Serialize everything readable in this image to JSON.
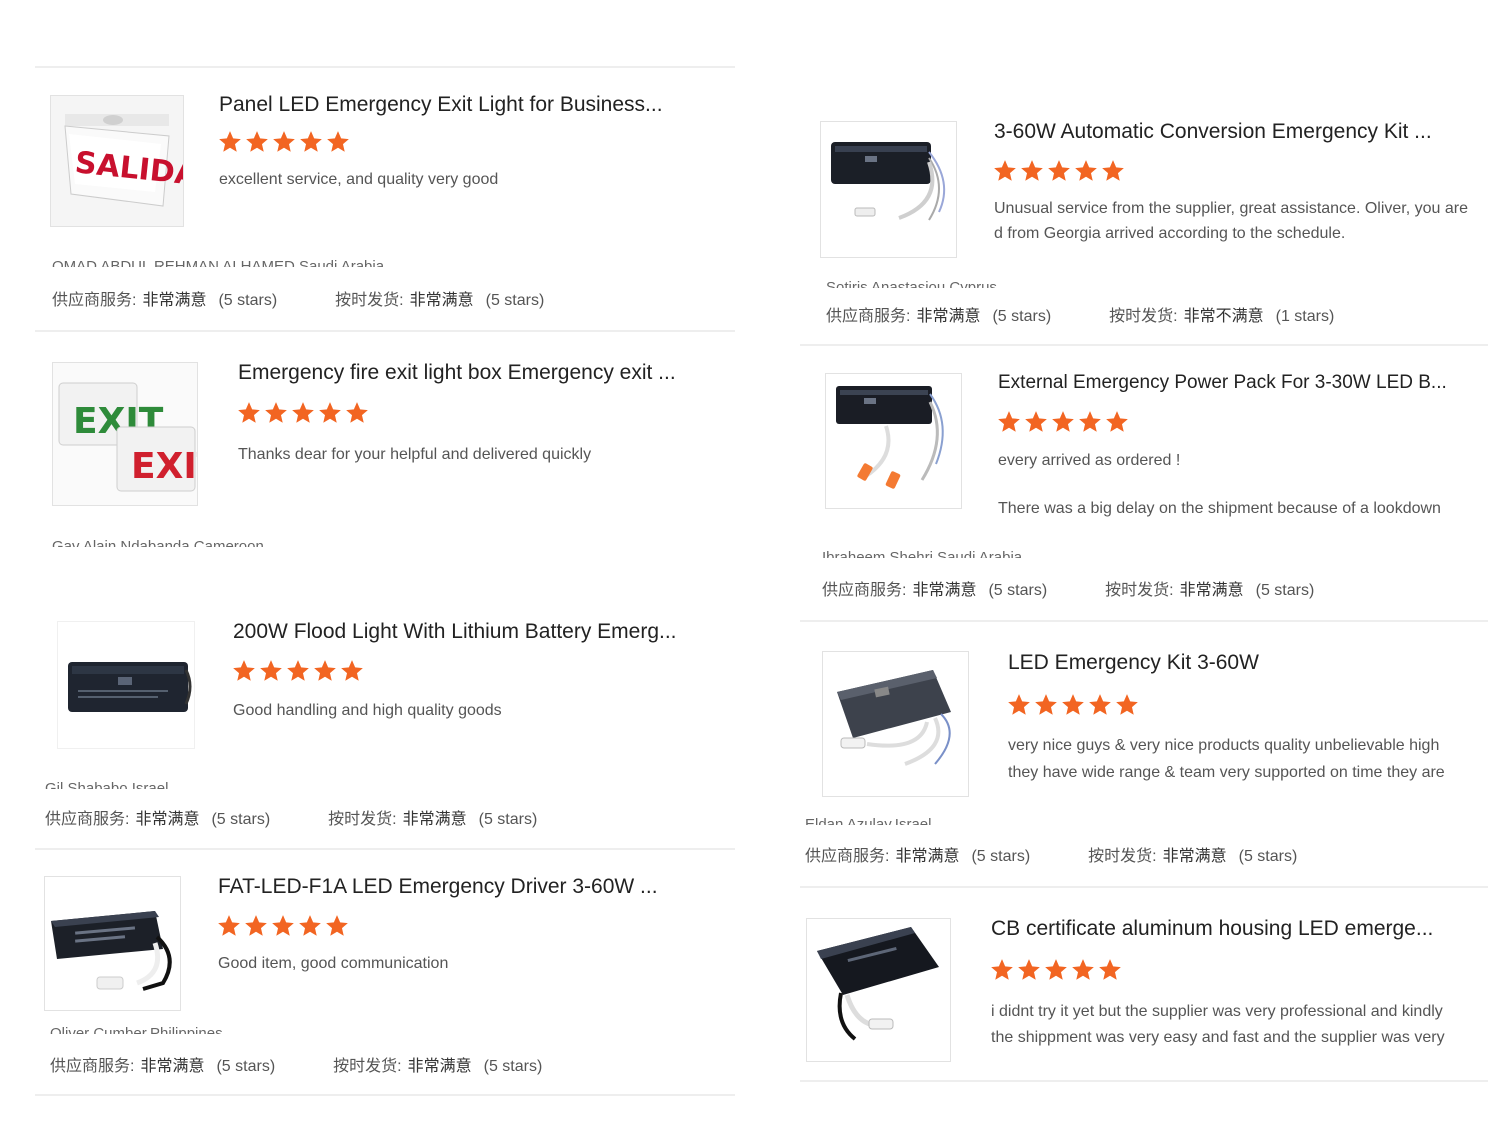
{
  "colors": {
    "star": "#f26522",
    "separator": "#eeeeee"
  },
  "labels": {
    "supplier_service": "供应商服务:",
    "on_time_shipment": "按时发货:"
  },
  "reviews": [
    {
      "title": "Panel LED Emergency Exit Light for Business...",
      "rating": 5,
      "comment": [
        "excellent service, and quality very good"
      ],
      "reviewer": "OMAD ABDUL REHMAN ALHAMED,Saudi Arabia",
      "supplier_value": "非常满意",
      "supplier_stars": "(5 stars)",
      "shipment_value": "非常满意",
      "shipment_stars": "(5 stars)",
      "image_icon": "salida-exit-sign-icon"
    },
    {
      "title": "Emergency fire exit light box Emergency exit ...",
      "rating": 5,
      "comment": [
        "Thanks dear for your helpful and delivered quickly"
      ],
      "reviewer": "Gav Alain Ndabanda,Cameroon",
      "image_icon": "exit-sign-icon"
    },
    {
      "title": "200W Flood Light With Lithium Battery Emerg...",
      "rating": 5,
      "comment": [
        "Good handling and high quality goods"
      ],
      "reviewer": "Gil Shababo,Israel",
      "supplier_value": "非常满意",
      "supplier_stars": "(5 stars)",
      "shipment_value": "非常满意",
      "shipment_stars": "(5 stars)",
      "image_icon": "emergency-driver-box-icon"
    },
    {
      "title": "FAT-LED-F1A LED Emergency Driver 3-60W ...",
      "rating": 5,
      "comment": [
        "Good item, good communication"
      ],
      "reviewer": "Oliver Cumber,Philippines",
      "supplier_value": "非常满意",
      "supplier_stars": "(5 stars)",
      "shipment_value": "非常满意",
      "shipment_stars": "(5 stars)",
      "image_icon": "emergency-driver-cable-icon"
    },
    {
      "title": "3-60W Automatic Conversion Emergency Kit ...",
      "rating": 5,
      "comment": [
        "Unusual service from the supplier, great assistance. Oliver, you are",
        "d from Georgia arrived according to the schedule."
      ],
      "reviewer": "Sotiris Anastasiou,Cyprus",
      "supplier_value": "非常满意",
      "supplier_stars": "(5 stars)",
      "shipment_value": "非常不满意",
      "shipment_stars": "(1 stars)",
      "image_icon": "emergency-kit-wires-icon"
    },
    {
      "title": "External Emergency Power Pack For 3-30W LED B...",
      "rating": 5,
      "comment": [
        "every arrived as ordered !",
        "There was a big delay on the shipment because of a lookdown"
      ],
      "reviewer": "Ibraheem Shehri,Saudi Arabia",
      "supplier_value": "非常满意",
      "supplier_stars": "(5 stars)",
      "shipment_value": "非常满意",
      "shipment_stars": "(5 stars)",
      "image_icon": "power-pack-icon"
    },
    {
      "title": "LED Emergency Kit 3-60W",
      "rating": 5,
      "comment": [
        "very nice guys & very nice products quality unbelievable high",
        "they have wide range & team very supported on time they are"
      ],
      "reviewer": "Eldan Azulay,Israel",
      "supplier_value": "非常满意",
      "supplier_stars": "(5 stars)",
      "shipment_value": "非常满意",
      "shipment_stars": "(5 stars)",
      "image_icon": "led-emergency-kit-icon"
    },
    {
      "title": "CB certificate aluminum housing LED emerge...",
      "rating": 5,
      "comment": [
        "i didnt try it yet but the supplier was very professional and kindly",
        "the shippment was very easy and fast and the supplier was very"
      ],
      "image_icon": "aluminum-housing-driver-icon"
    }
  ]
}
